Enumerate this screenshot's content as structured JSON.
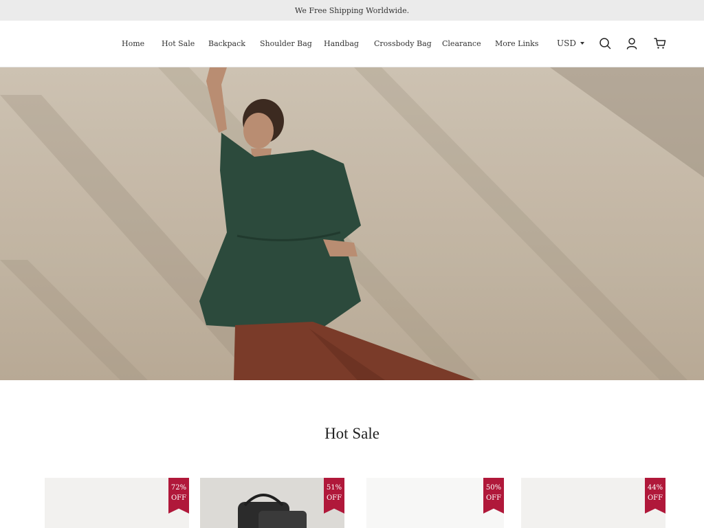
{
  "announcement": "We Free Shipping Worldwide.",
  "nav": {
    "links": [
      "Home",
      "Hot Sale",
      "Backpack",
      "Shoulder Bag",
      "Handbag",
      "Crossbody Bag",
      "Clearance",
      "More Links"
    ],
    "currency": "USD",
    "icons": [
      "search-icon",
      "account-icon",
      "cart-icon"
    ]
  },
  "hot_sale": {
    "title": "Hot Sale",
    "products": [
      {
        "discount": "72%",
        "off": "OFF"
      },
      {
        "discount": "51%",
        "off": "OFF"
      },
      {
        "discount": "50%",
        "off": "OFF"
      },
      {
        "discount": "44%",
        "off": "OFF"
      }
    ]
  },
  "colors": {
    "badge": "#b0183a",
    "announcement_bg": "#ebebeb"
  }
}
